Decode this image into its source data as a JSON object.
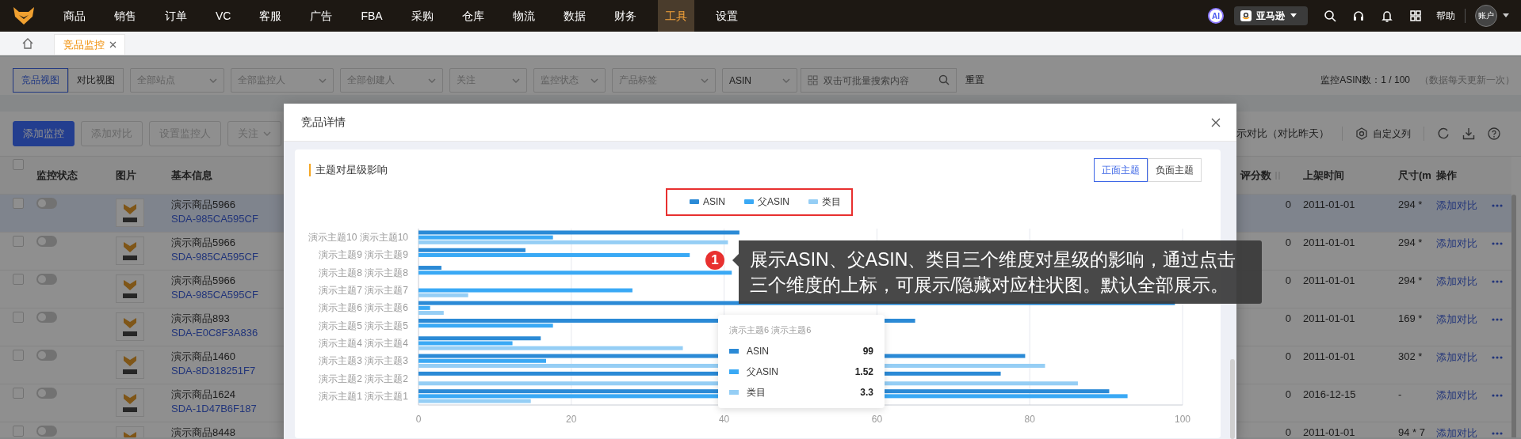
{
  "top_nav": {
    "menu": [
      {
        "label": "商品",
        "selected": false
      },
      {
        "label": "销售",
        "selected": false
      },
      {
        "label": "订单",
        "selected": false
      },
      {
        "label": "VC",
        "selected": false
      },
      {
        "label": "客服",
        "selected": false
      },
      {
        "label": "广告",
        "selected": false
      },
      {
        "label": "FBA",
        "selected": false
      },
      {
        "label": "采购",
        "selected": false
      },
      {
        "label": "仓库",
        "selected": false
      },
      {
        "label": "物流",
        "selected": false
      },
      {
        "label": "数据",
        "selected": false
      },
      {
        "label": "财务",
        "selected": false
      },
      {
        "label": "工具",
        "selected": true
      },
      {
        "label": "设置",
        "selected": false
      }
    ],
    "ai_badge": "AI",
    "store": "亚马逊",
    "help": "帮助",
    "account": "账户"
  },
  "tabs": [
    {
      "label": "竞品监控",
      "selected": true
    }
  ],
  "filters": {
    "views": [
      {
        "label": "竞品视图",
        "selected": true
      },
      {
        "label": "对比视图",
        "selected": false
      }
    ],
    "selects": [
      {
        "placeholder": "全部站点"
      },
      {
        "placeholder": "全部监控人"
      },
      {
        "placeholder": "全部创建人"
      },
      {
        "placeholder": "关注"
      },
      {
        "placeholder": "监控状态"
      },
      {
        "placeholder": "产品标签"
      }
    ],
    "search_type": "ASIN",
    "search": {
      "placeholder": "双击可批量搜索内容"
    },
    "reset": "重置",
    "quota": "监控ASIN数：1 / 100",
    "note": "（数据每天更新一次）"
  },
  "toolbar": {
    "buttons": [
      {
        "label": "添加监控",
        "kind": "primary",
        "disabled": false
      },
      {
        "label": "添加对比",
        "kind": "button",
        "disabled": true
      },
      {
        "label": "设置监控人",
        "kind": "button",
        "disabled": true
      },
      {
        "label": "关注",
        "kind": "dropdown",
        "disabled": true
      }
    ],
    "compare": "示对比（对比昨天）",
    "custom_columns": "自定义列"
  },
  "table": {
    "select_all": {
      "checked": false
    },
    "columns_left": [
      "监控状态",
      "图片",
      "基本信息"
    ],
    "columns_right": [
      "评分数",
      "上架时间",
      "尺寸(m",
      "操作"
    ],
    "rows": [
      {
        "checked": false,
        "monitoring": false,
        "hovered": true,
        "name": "演示商品5966",
        "sku": "SDA-985CA595CF",
        "ratings": "0",
        "listed": "2011-01-01",
        "size": "294 *",
        "action": "添加对比"
      },
      {
        "checked": false,
        "monitoring": false,
        "hovered": false,
        "name": "演示商品5966",
        "sku": "SDA-985CA595CF",
        "ratings": "0",
        "listed": "2011-01-01",
        "size": "294 *",
        "action": "添加对比"
      },
      {
        "checked": false,
        "monitoring": false,
        "hovered": false,
        "name": "演示商品5966",
        "sku": "SDA-985CA595CF",
        "ratings": "0",
        "listed": "2011-01-01",
        "size": "294 *",
        "action": "添加对比"
      },
      {
        "checked": false,
        "monitoring": false,
        "hovered": false,
        "name": "演示商品893",
        "sku": "SDA-E0C8F3A836",
        "ratings": "0",
        "listed": "2011-01-01",
        "size": "169 *",
        "action": "添加对比"
      },
      {
        "checked": false,
        "monitoring": false,
        "hovered": false,
        "name": "演示商品1460",
        "sku": "SDA-8D318251F7",
        "ratings": "0",
        "listed": "2011-01-01",
        "size": "302 *",
        "action": "添加对比"
      },
      {
        "checked": false,
        "monitoring": false,
        "hovered": false,
        "name": "演示商品1624",
        "sku": "SDA-1D47B6F187",
        "ratings": "0",
        "listed": "2016-12-15",
        "size": "-",
        "action": "添加对比"
      },
      {
        "checked": false,
        "monitoring": false,
        "hovered": false,
        "name": "演示商品8448",
        "ratings": "0",
        "listed": "2011-01-01",
        "size": "94 * 7",
        "action": "添加对比"
      }
    ]
  },
  "modal": {
    "title": "竞品详情",
    "card": {
      "title": "主题对星级影响",
      "theme_tabs": [
        {
          "label": "正面主题",
          "selected": true
        },
        {
          "label": "负面主题",
          "selected": false
        }
      ],
      "chart_data": {
        "type": "bar",
        "orientation": "horizontal",
        "categories": [
          "演示主题10 演示主题10",
          "演示主题9 演示主题9",
          "演示主题8 演示主题8",
          "演示主题7 演示主题7",
          "演示主题6 演示主题6",
          "演示主题5 演示主题5",
          "演示主题4 演示主题4",
          "演示主题3 演示主题3",
          "演示主题2 演示主题2",
          "演示主题1 演示主题1"
        ],
        "series": [
          {
            "name": "ASIN",
            "color": "#2b8ad6",
            "values": [
              42,
              14,
              3,
              null,
              99,
              65,
              16,
              79.4,
              76.2,
              90.4
            ]
          },
          {
            "name": "父ASIN",
            "color": "#3aa9f5",
            "values": [
              17.6,
              35.5,
              41,
              28,
              1.52,
              17.6,
              12.3,
              16.7,
              null,
              92.8
            ]
          },
          {
            "name": "类目",
            "color": "#95cef5",
            "values": [
              40.5,
              null,
              null,
              6.5,
              3.3,
              null,
              34.6,
              82,
              86.3,
              14.7
            ]
          }
        ],
        "xlim": [
          0,
          100
        ],
        "xticks": [
          0,
          20,
          40,
          60,
          80,
          100
        ],
        "grid": true,
        "legend": "top"
      },
      "tooltip": {
        "title": "演示主题6 演示主题6",
        "rows": [
          {
            "name": "ASIN",
            "value": "99"
          },
          {
            "name": "父ASIN",
            "value": "1.52"
          },
          {
            "name": "类目",
            "value": "3.3"
          }
        ]
      }
    }
  },
  "annotation": {
    "number": "1",
    "text": "展示ASIN、父ASIN、类目三个维度对星级的影响，通过点击三个维度的上标，可展示/隐藏对应柱状图。默认全部展示。",
    "highlight_legend": true
  }
}
